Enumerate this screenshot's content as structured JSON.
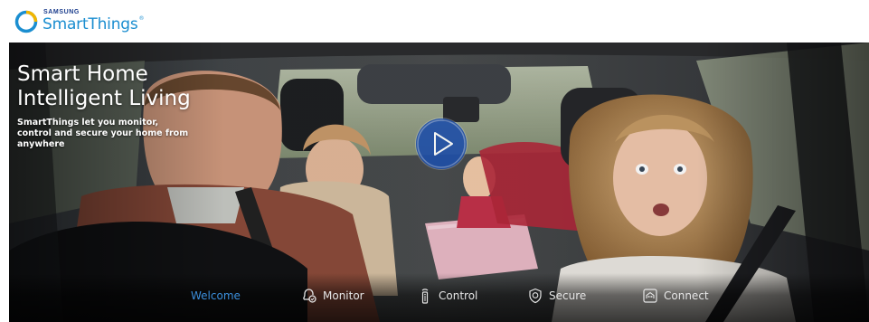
{
  "brand": {
    "maker": "SAMSUNG",
    "product": "SmartThings",
    "trademark": "®",
    "ring_color": "#1b8ed0",
    "text_color": "#1b8ed0"
  },
  "hero": {
    "title_line1": "Smart Home",
    "title_line2": "Intelligent Living",
    "subtitle": "SmartThings let you monitor, control and secure your home from anywhere",
    "play_icon": "play-icon"
  },
  "nav": {
    "accent_color": "#3b8fdc",
    "items": [
      {
        "label": "Welcome",
        "icon": "",
        "active": true
      },
      {
        "label": "Monitor",
        "icon": "bell-alert-icon",
        "active": false
      },
      {
        "label": "Control",
        "icon": "remote-icon",
        "active": false
      },
      {
        "label": "Secure",
        "icon": "shield-icon",
        "active": false
      },
      {
        "label": "Connect",
        "icon": "home-connect-icon",
        "active": false
      }
    ]
  }
}
